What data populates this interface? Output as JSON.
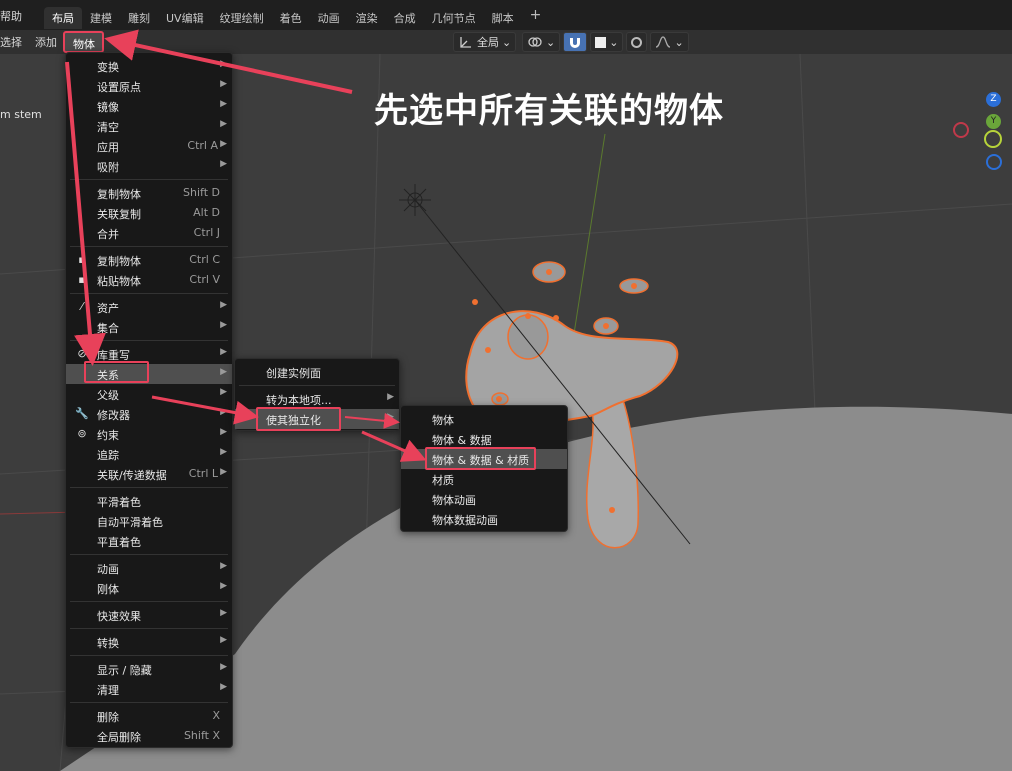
{
  "topbar": {
    "help": "帮助",
    "tabs": [
      "布局",
      "建模",
      "雕刻",
      "UV编辑",
      "纹理绘制",
      "着色",
      "动画",
      "渲染",
      "合成",
      "几何节点",
      "脚本"
    ],
    "add_tab": "+"
  },
  "header": {
    "select": "选择",
    "add": "添加",
    "object": "物体",
    "transform_orientation": "全局"
  },
  "viewport": {
    "side_label": "m stem",
    "caption": "先选中所有关联的物体",
    "gizmo": {
      "z_label": "Z",
      "y_label": "Y"
    }
  },
  "object_menu": {
    "items": [
      {
        "label": "变换",
        "shortcut": "",
        "submenu": true
      },
      {
        "label": "设置原点",
        "shortcut": "",
        "submenu": true
      },
      {
        "label": "镜像",
        "shortcut": "",
        "submenu": true
      },
      {
        "label": "清空",
        "shortcut": "",
        "submenu": true
      },
      {
        "label": "应用",
        "shortcut": "Ctrl A",
        "submenu": true
      },
      {
        "label": "吸附",
        "shortcut": "",
        "submenu": true
      },
      {
        "label": "复制物体",
        "shortcut": "Shift D",
        "submenu": false
      },
      {
        "label": "关联复制",
        "shortcut": "Alt D",
        "submenu": false
      },
      {
        "label": "合并",
        "shortcut": "Ctrl J",
        "submenu": false
      },
      {
        "label": "复制物体",
        "shortcut": "Ctrl C",
        "submenu": false
      },
      {
        "label": "粘贴物体",
        "shortcut": "Ctrl V",
        "submenu": false
      },
      {
        "label": "资产",
        "shortcut": "",
        "submenu": true
      },
      {
        "label": "集合",
        "shortcut": "",
        "submenu": true
      },
      {
        "label": "库重写",
        "shortcut": "",
        "submenu": true
      },
      {
        "label": "关系",
        "shortcut": "",
        "submenu": true
      },
      {
        "label": "父级",
        "shortcut": "",
        "submenu": true
      },
      {
        "label": "修改器",
        "shortcut": "",
        "submenu": true
      },
      {
        "label": "约束",
        "shortcut": "",
        "submenu": true
      },
      {
        "label": "追踪",
        "shortcut": "",
        "submenu": true
      },
      {
        "label": "关联/传递数据",
        "shortcut": "Ctrl L",
        "submenu": true
      },
      {
        "label": "平滑着色",
        "shortcut": "",
        "submenu": false
      },
      {
        "label": "自动平滑着色",
        "shortcut": "",
        "submenu": false
      },
      {
        "label": "平直着色",
        "shortcut": "",
        "submenu": false
      },
      {
        "label": "动画",
        "shortcut": "",
        "submenu": true
      },
      {
        "label": "刚体",
        "shortcut": "",
        "submenu": true
      },
      {
        "label": "快速效果",
        "shortcut": "",
        "submenu": true
      },
      {
        "label": "转换",
        "shortcut": "",
        "submenu": true
      },
      {
        "label": "显示 / 隐藏",
        "shortcut": "",
        "submenu": true
      },
      {
        "label": "清理",
        "shortcut": "",
        "submenu": true
      },
      {
        "label": "删除",
        "shortcut": "X",
        "submenu": false
      },
      {
        "label": "全局删除",
        "shortcut": "Shift X",
        "submenu": false
      }
    ]
  },
  "relations_menu": {
    "items": [
      "创建实例面",
      "转为本地项...",
      "使其独立化"
    ]
  },
  "single_user_menu": {
    "items": [
      "物体",
      "物体 & 数据",
      "物体 & 数据 & 材质",
      "材质",
      "物体动画",
      "物体数据动画"
    ]
  },
  "colors": {
    "accent_red": "#e8415a",
    "selection_orange": "#f07030",
    "menu_bg": "#181818",
    "highlight": "#4f4f4f"
  }
}
